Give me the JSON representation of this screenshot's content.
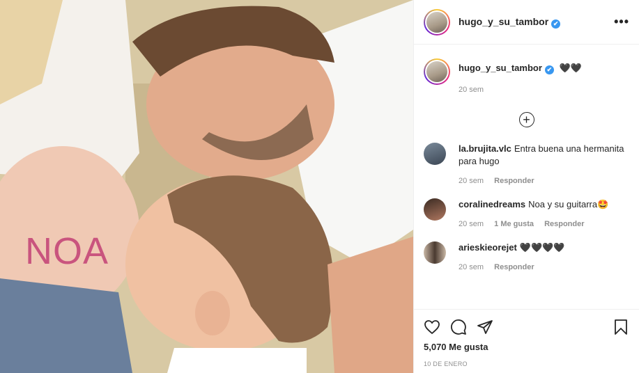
{
  "photo": {
    "belly_text": "NOA"
  },
  "header": {
    "username": "hugo_y_su_tambor",
    "verified": "✔",
    "more": "•••"
  },
  "caption": {
    "username": "hugo_y_su_tambor",
    "verified": "✔",
    "text": "🖤🖤",
    "time": "20 sem"
  },
  "load_more": "+",
  "comments": [
    {
      "user": "la.brujita.vlc",
      "text": "Entra buena una hermanita para hugo",
      "time": "20 sem",
      "likes": "",
      "reply": "Responder"
    },
    {
      "user": "coralinedreams",
      "text": "Noa y su guitarra🤩",
      "time": "20 sem",
      "likes": "1 Me gusta",
      "reply": "Responder"
    },
    {
      "user": "arieskieorejet",
      "text": "🖤🖤🖤🖤",
      "time": "20 sem",
      "likes": "",
      "reply": "Responder"
    }
  ],
  "likes": "5,070 Me gusta",
  "date": "10 DE ENERO",
  "colors": {
    "accent": "#3897f0",
    "text": "#262626",
    "muted": "#8e8e8e",
    "belly_text": "#c9547e"
  },
  "icons": [
    "heart-icon",
    "comment-icon",
    "share-icon",
    "bookmark-icon",
    "more-icon",
    "verified-icon",
    "plus-circle-icon"
  ]
}
